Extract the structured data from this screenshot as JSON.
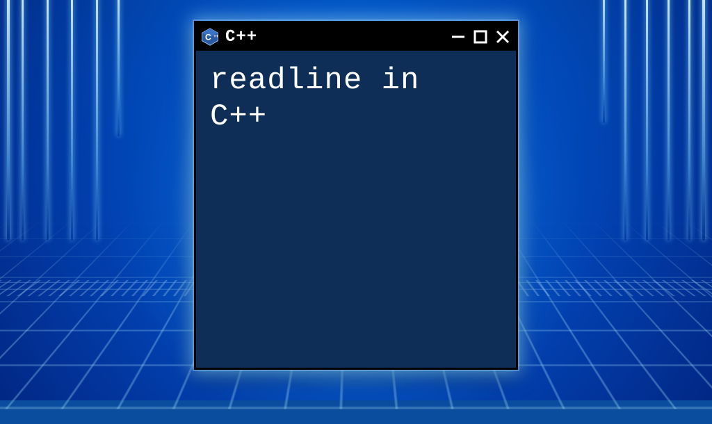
{
  "window": {
    "title": "C++",
    "icon_name": "cpp-hex-icon",
    "icon_letter": "C",
    "controls": {
      "minimize": "minimize-button",
      "maximize": "maximize-button",
      "close": "close-button"
    }
  },
  "content": {
    "text": "readline in\nC++"
  },
  "colors": {
    "client_bg": "#0e2e57",
    "titlebar_bg": "#000000",
    "accent_glow": "#78d2ff"
  }
}
